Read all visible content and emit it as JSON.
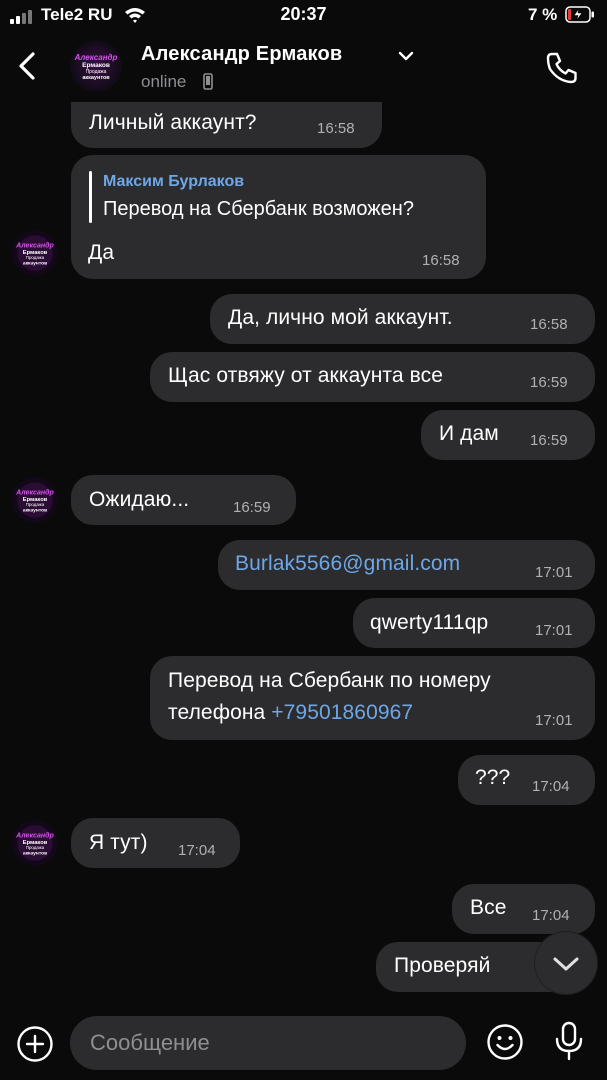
{
  "status_bar": {
    "carrier": "Tele2 RU",
    "time": "20:37",
    "battery": "7 %"
  },
  "header": {
    "contact_name": "Александр Ермаков",
    "status": "online",
    "avatar_text": [
      "Александр",
      "Ермаков",
      "Продажа",
      "аккаунтов"
    ]
  },
  "messages": [
    {
      "side": "in",
      "text": "Личный аккаунт?",
      "time": "16:58"
    },
    {
      "side": "in",
      "reply_author": "Максим Бурлаков",
      "reply_text": "Перевод на Сбербанк возможен?",
      "text": "Да",
      "time": "16:58"
    },
    {
      "side": "out",
      "text": "Да, лично мой аккаунт.",
      "time": "16:58"
    },
    {
      "side": "out",
      "text": "Щас отвяжу от аккаунта все",
      "time": "16:59"
    },
    {
      "side": "out",
      "text": "И дам",
      "time": "16:59"
    },
    {
      "side": "in",
      "text": "Ожидаю...",
      "time": "16:59"
    },
    {
      "side": "out",
      "text": "Burlak5566@gmail.com",
      "time": "17:01"
    },
    {
      "side": "out",
      "text": "qwerty111qp",
      "time": "17:01"
    },
    {
      "side": "out",
      "text_line1": "Перевод на Сбербанк по номеру",
      "text_line2_prefix": "телефона ",
      "text_line2_link": "+79501860967",
      "time": "17:01"
    },
    {
      "side": "out",
      "text": "???",
      "time": "17:04"
    },
    {
      "side": "in",
      "text": "Я тут)",
      "time": "17:04"
    },
    {
      "side": "out",
      "text": "Все",
      "time": "17:04"
    },
    {
      "side": "out",
      "text": "Проверяй",
      "time": ""
    }
  ],
  "input": {
    "placeholder": "Сообщение"
  },
  "colors": {
    "background": "#0a0a0a",
    "bubble": "#2c2c2e",
    "link": "#6ea7e6",
    "muted": "#8e8e93",
    "avatar_accent": "#c44bd6"
  },
  "icons": [
    "back-chevron-icon",
    "chevron-down-icon",
    "phone-icon",
    "mobile-device-icon",
    "plus-circle-icon",
    "emoji-icon",
    "microphone-icon",
    "scroll-down-chevron-icon"
  ]
}
